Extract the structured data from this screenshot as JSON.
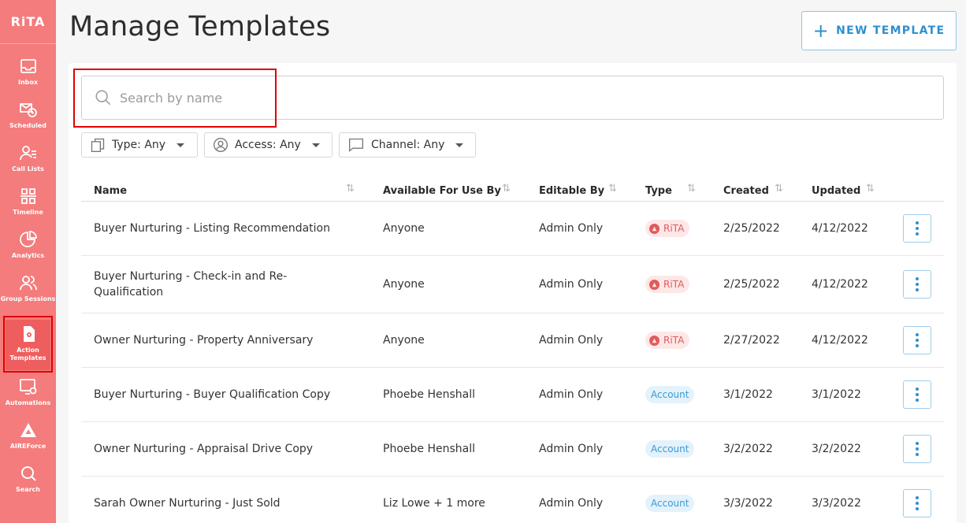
{
  "sidebar": {
    "logo": "RiTA",
    "items": [
      {
        "label": "Inbox",
        "icon": "inbox-icon"
      },
      {
        "label": "Scheduled",
        "icon": "scheduled-icon"
      },
      {
        "label": "Call Lists",
        "icon": "call-lists-icon"
      },
      {
        "label": "Timeline",
        "icon": "timeline-icon"
      },
      {
        "label": "Analytics",
        "icon": "analytics-icon"
      },
      {
        "label": "Group Sessions",
        "icon": "group-sessions-icon"
      },
      {
        "label": "Action Templates",
        "icon": "action-templates-icon"
      },
      {
        "label": "Automations",
        "icon": "automations-icon"
      },
      {
        "label": "AIREForce",
        "icon": "aireforce-icon"
      },
      {
        "label": "Search",
        "icon": "search-icon"
      }
    ],
    "active_index": 6
  },
  "header": {
    "title": "Manage Templates",
    "new_button": "NEW TEMPLATE"
  },
  "search": {
    "placeholder": "Search by name",
    "value": ""
  },
  "filters": {
    "type": "Type: Any",
    "access": "Access: Any",
    "channel": "Channel: Any"
  },
  "table": {
    "columns": [
      "Name",
      "Available For Use By",
      "Editable By",
      "Type",
      "Created",
      "Updated"
    ],
    "rows": [
      {
        "name": "Buyer Nurturing - Listing Recommendation",
        "available": "Anyone",
        "editable": "Admin Only",
        "type": "RiTA",
        "created": "2/25/2022",
        "updated": "4/12/2022"
      },
      {
        "name": "Buyer Nurturing - Check-in and Re-Qualification",
        "available": "Anyone",
        "editable": "Admin Only",
        "type": "RiTA",
        "created": "2/25/2022",
        "updated": "4/12/2022"
      },
      {
        "name": "Owner Nurturing - Property Anniversary",
        "available": "Anyone",
        "editable": "Admin Only",
        "type": "RiTA",
        "created": "2/27/2022",
        "updated": "4/12/2022"
      },
      {
        "name": "Buyer Nurturing - Buyer Qualification Copy",
        "available": "Phoebe Henshall",
        "editable": "Admin Only",
        "type": "Account",
        "created": "3/1/2022",
        "updated": "3/1/2022"
      },
      {
        "name": "Owner Nurturing - Appraisal Drive Copy",
        "available": "Phoebe Henshall",
        "editable": "Admin Only",
        "type": "Account",
        "created": "3/2/2022",
        "updated": "3/2/2022"
      },
      {
        "name": "Sarah Owner Nurturing - Just Sold",
        "available": "Liz Lowe + 1 more",
        "editable": "Admin Only",
        "type": "Account",
        "created": "3/3/2022",
        "updated": "3/3/2022"
      }
    ]
  },
  "colors": {
    "sidebar": "#f47c7c",
    "accent": "#2f8fcf",
    "rita_badge": "#e25a5a",
    "account_badge": "#3a9ad4",
    "highlight": "#e00000"
  }
}
